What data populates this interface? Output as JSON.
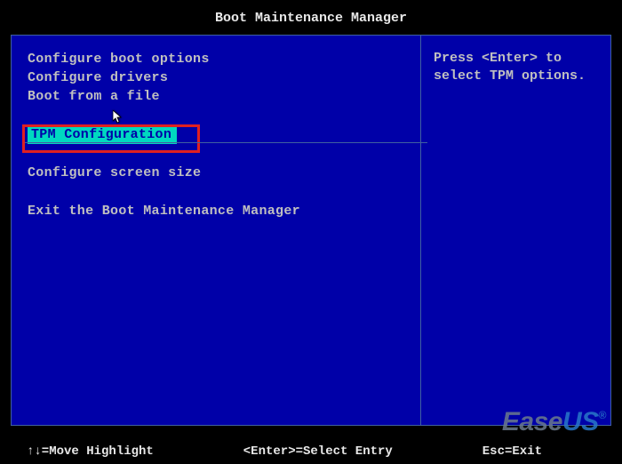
{
  "title": "Boot Maintenance Manager",
  "menu": {
    "items": [
      {
        "label": "Configure boot options"
      },
      {
        "label": "Configure drivers"
      },
      {
        "label": "Boot from a file"
      },
      {
        "label": "TPM Configuration"
      },
      {
        "label": "Configure screen size"
      },
      {
        "label": "Exit the Boot Maintenance Manager"
      }
    ],
    "selected_index": 3
  },
  "help_panel": {
    "text": "Press <Enter> to select TPM options."
  },
  "footer": {
    "left": "↑↓=Move Highlight",
    "center": "<Enter>=Select Entry",
    "right": "Esc=Exit"
  },
  "watermark": {
    "part1": "Ease",
    "part2": "US",
    "reg": "®"
  }
}
